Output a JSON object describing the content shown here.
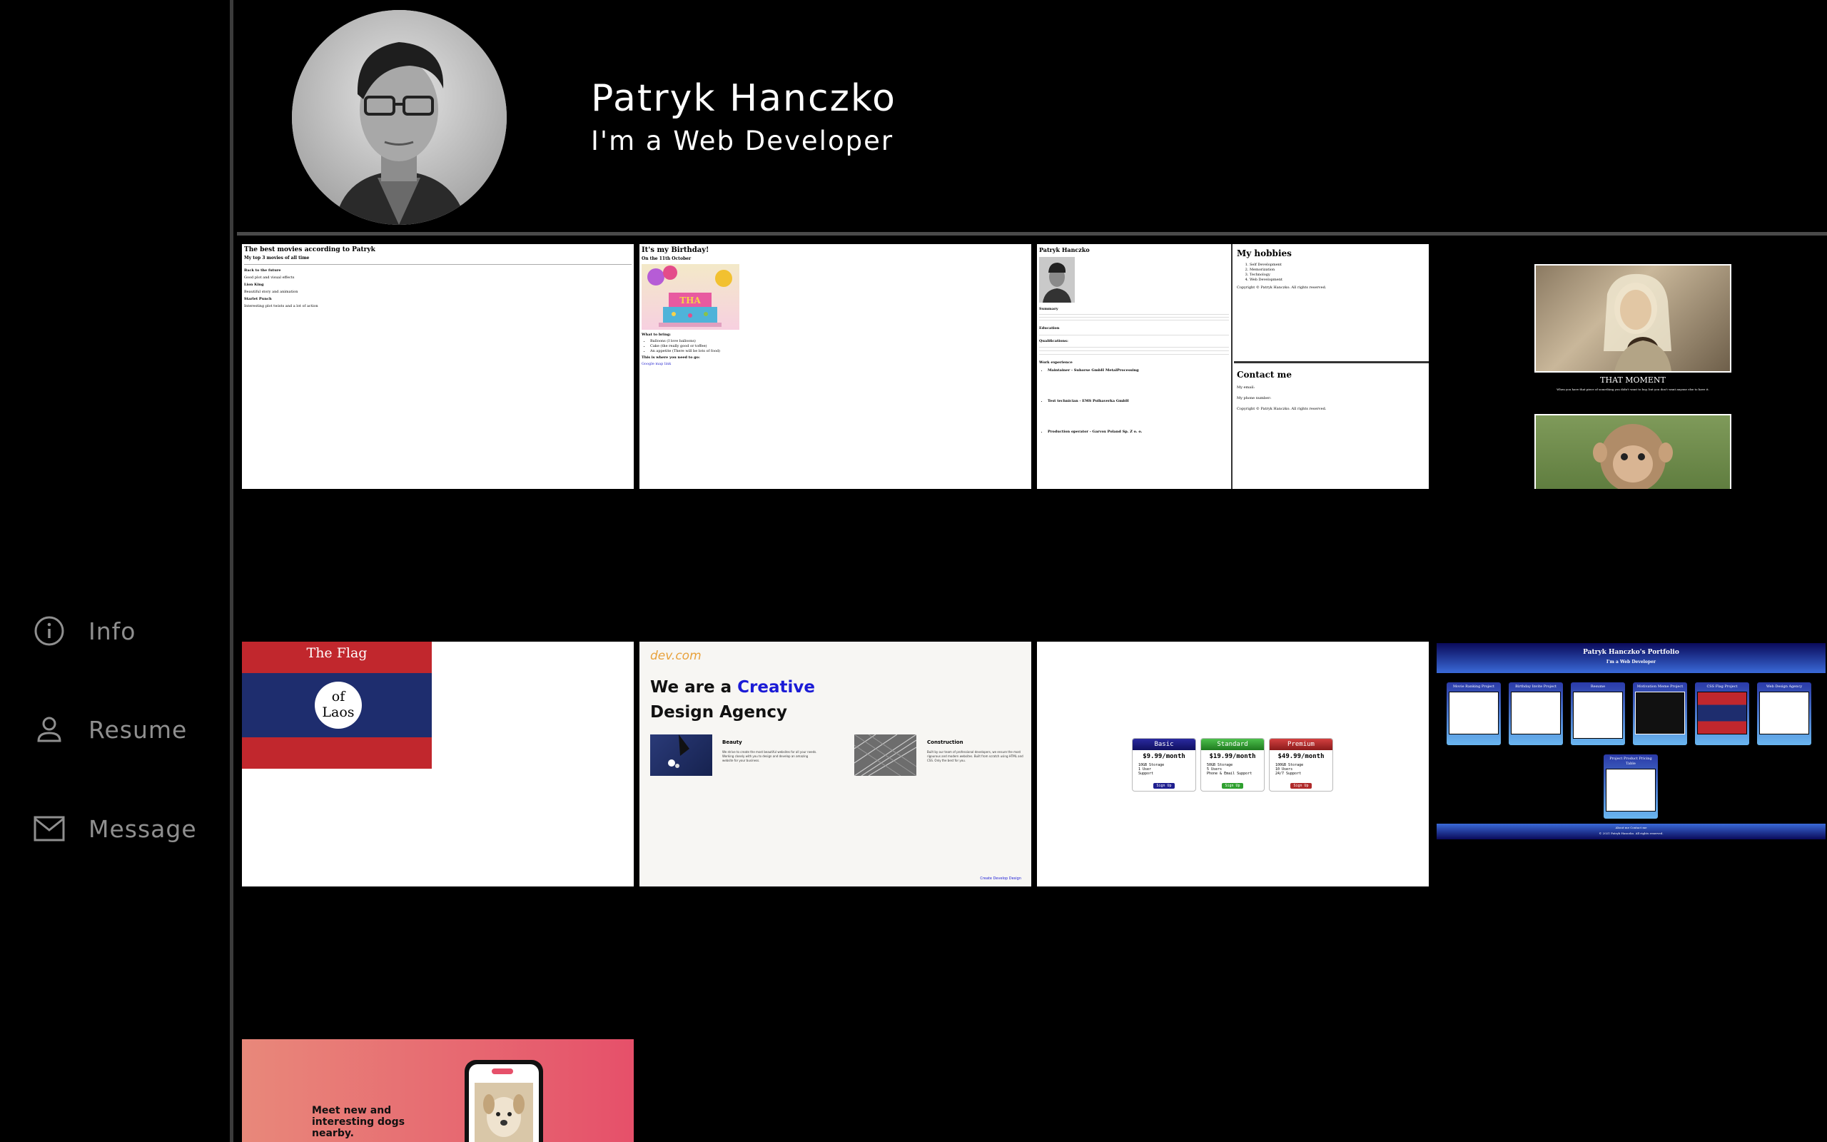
{
  "sidebar": {
    "items": [
      {
        "label": "Info",
        "icon": "info-icon"
      },
      {
        "label": "Resume",
        "icon": "person-icon"
      },
      {
        "label": "Message",
        "icon": "mail-icon"
      }
    ]
  },
  "header": {
    "name": "Patryk Hanczko",
    "role": "I'm a Web Developer"
  },
  "projects": {
    "movies": {
      "title": "The best movies according to Patryk",
      "subtitle": "My top 3 movies of all time",
      "items": [
        {
          "name": "Back to the future",
          "desc": "Good plot and visual effects"
        },
        {
          "name": "Lion King",
          "desc": "Beautiful story and animation"
        },
        {
          "name": "Starlet Punch",
          "desc": "Interesting plot twists and a lot of action"
        }
      ]
    },
    "birthday": {
      "title": "It's my Birthday!",
      "subtitle": "On the 11th October",
      "bring_title": "What to bring:",
      "bring": [
        "Balloons (I love balloons)",
        "Cake (the really good or toffee)",
        "An appetite (There will be lots of food)"
      ],
      "where": "This is where you need to go:",
      "link": "Google map link"
    },
    "resume": {
      "name": "Patryk Hanczko",
      "summary_h": "Summary",
      "education_h": "Education",
      "qualifications_h": "Qualifications:",
      "work_h": "Work experience",
      "jobs": [
        "Maintainer - Suhorse GmbH MetalProcessing",
        "Test technician - EMS Polhaverka GmbH",
        "Production operator - Garvox Poland Sp. Z o. o."
      ],
      "hobbies_h": "My hobbies",
      "hobbies": [
        "Self Development",
        "Memorization",
        "Technology",
        "Web Development"
      ],
      "copyright": "Copyright © Patryk Hanczko. All rights reserved.",
      "contact_h": "Contact me",
      "email": "My email:",
      "phone": "My phone number:"
    },
    "motivation": {
      "caption": "THAT MOMENT",
      "text": "When you have that piece of something you didn't want to buy, but you don't want anyone else to have it."
    },
    "flag": {
      "title": "The Flag",
      "of": "of",
      "laos": "Laos"
    },
    "agency": {
      "logo": "dev.com",
      "headline_1": "We are a ",
      "headline_accent": "Creative",
      "headline_2": "Design Agency",
      "beauty_h": "Beauty",
      "beauty_t": "We strive to create the most beautiful websites for all your needs. Working closely with you to design and develop an amazing website for your business.",
      "construction_h": "Construction",
      "construction_t": "Built by our team of professional developers, we ensure the most rigourous and modern websites. Built from scratch using HTML and CSS. Only the best for you.",
      "footer": "Create Develop Design"
    },
    "pricing": {
      "plans": [
        {
          "name": "Basic",
          "price": "$9.99/month",
          "f1": "10GB Storage",
          "f2": "1 User",
          "f3": "Support",
          "btn": "Sign Up",
          "color": "#1f1f8f"
        },
        {
          "name": "Standard",
          "price": "$19.99/month",
          "f1": "50GB Storage",
          "f2": "5 Users",
          "f3": "Phone & Email Support",
          "btn": "Sign Up",
          "color": "#2fa02f"
        },
        {
          "name": "Premium",
          "price": "$49.99/month",
          "f1": "100GB Storage",
          "f2": "10 Users",
          "f3": "24/7 Support",
          "btn": "Sign Up",
          "color": "#b02a2a"
        }
      ]
    },
    "portfolio": {
      "title": "Patryk Hanczko's Portfolio",
      "subtitle": "I'm a Web Developer",
      "cards": [
        "Movie Ranking Project",
        "Birthday Invite Project",
        "Resume",
        "Motivation Meme Project",
        "CSS Flag Project",
        "Web Design Agency",
        "Project Product Pricing Table"
      ],
      "footer_links": "About me   Contact me",
      "footer_copy": "© 2021 Patryk Hanczko. All rights reserved."
    },
    "dogs": {
      "headline": "Meet new and interesting dogs nearby."
    }
  },
  "colors": {
    "background": "#000000",
    "nav_text": "#8f8f8f",
    "agency_accent": "#1b1bd6",
    "agency_logo": "#e8a23c",
    "flag_red": "#c1272d",
    "flag_blue": "#1e2d6e",
    "dogs_gradient_start": "#e8887a",
    "dogs_gradient_end": "#e6506a"
  }
}
